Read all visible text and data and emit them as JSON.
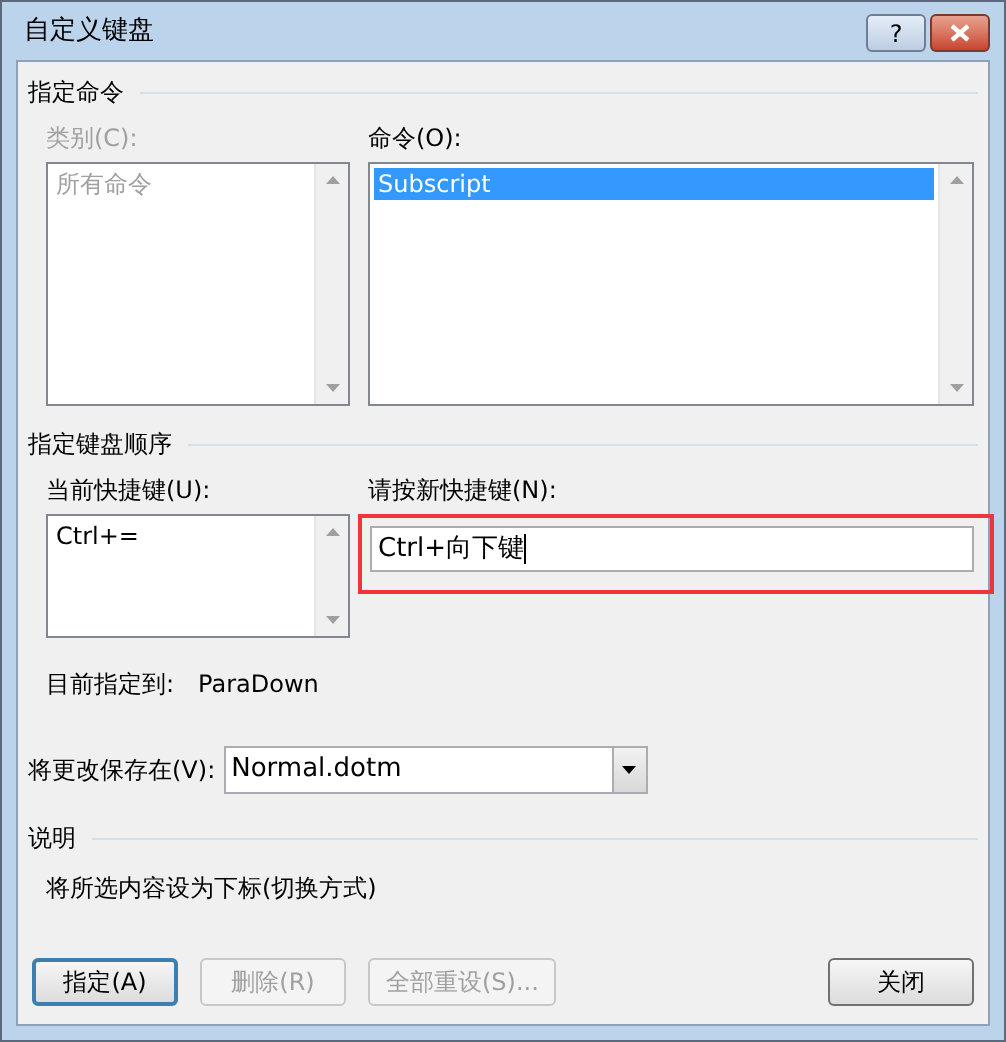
{
  "window": {
    "title": "自定义键盘",
    "help": "?"
  },
  "command_section": {
    "heading": "指定命令",
    "categories": {
      "label": "类别(C):",
      "disabled": true,
      "items": [
        {
          "label": "所有命令",
          "selected": false
        }
      ]
    },
    "commands": {
      "label": "命令(O):",
      "items": [
        {
          "label": "Subscript",
          "selected": true
        }
      ]
    }
  },
  "keyboard_section": {
    "heading": "指定键盘顺序",
    "current_keys": {
      "label": "当前快捷键(U):",
      "items": [
        {
          "label": "Ctrl+=",
          "selected": false
        }
      ]
    },
    "new_key": {
      "label": "请按新快捷键(N):",
      "value": "Ctrl+向下键",
      "highlighted": true
    },
    "assigned": {
      "label": "目前指定到:",
      "value": "ParaDown"
    }
  },
  "save_in": {
    "label": "将更改保存在(V):",
    "value": "Normal.dotm"
  },
  "description": {
    "heading": "说明",
    "text": "将所选内容设为下标(切换方式)"
  },
  "buttons": [
    {
      "label": "指定(A)",
      "disabled": false,
      "default": true
    },
    {
      "label": "删除(R)",
      "disabled": true,
      "default": false
    },
    {
      "label": "全部重设(S)...",
      "disabled": true,
      "default": false
    },
    {
      "label": "关闭",
      "disabled": false,
      "default": false
    }
  ]
}
